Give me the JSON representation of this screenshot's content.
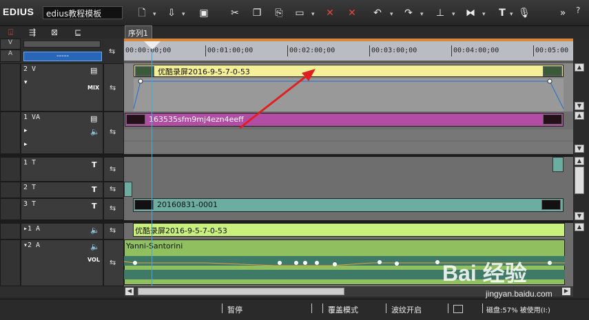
{
  "app": {
    "logo": "EDIUS",
    "project_name": "edius教程模板"
  },
  "toolbar": {
    "icons": [
      "new-file-icon",
      "open-icon",
      "save-icon",
      "cut-icon",
      "copy-icon",
      "paste-icon",
      "clip-icon",
      "delete-icon",
      "ripple-delete-icon",
      "undo-icon",
      "redo-icon",
      "split-icon",
      "group-icon",
      "title-icon",
      "mic-icon",
      "more-icon"
    ]
  },
  "sequence": {
    "tab_label": "序列1"
  },
  "left_tools": {
    "track_selector": "-----"
  },
  "ruler": {
    "ticks": [
      "00:00:00;00",
      "00:01:00;00",
      "00:02:00;00",
      "00:03:00;00",
      "00:04:00;00",
      "00:05:00"
    ]
  },
  "tracks": {
    "v2": {
      "name": "2 V",
      "mix_label": "MIX"
    },
    "va1": {
      "name": "1 VA"
    },
    "t1": {
      "name": "1 T",
      "icon": "T"
    },
    "t2": {
      "name": "2 T",
      "icon": "T"
    },
    "t3": {
      "name": "3 T",
      "icon": "T"
    },
    "a1": {
      "name": "▸1 A"
    },
    "a2": {
      "name": "▾2 A",
      "vol_label": "VOL"
    }
  },
  "clips": {
    "v2_clip": "优酷录屏2016-9-5-7-0-53",
    "va1_clip": "163535sfm9mj4ezn4eeff",
    "t3_clip": "20160831-0001",
    "a1_clip": "优酷录屏2016-9-5-7-0-53",
    "a2_clip": "Yanni-Santorini"
  },
  "status": {
    "pause": "暂停",
    "overwrite": "覆盖模式",
    "ripple": "波纹开启",
    "disk": "磁盘:57% 被使用(I:)"
  },
  "watermark": {
    "brand": "Bai 经验",
    "url": "jingyan.baidu.com"
  },
  "colors": {
    "v2_clip": "#f5ef98",
    "va1_clip": "#b14ea3",
    "t3_clip": "#6bada0",
    "a1_clip": "#c9ef7c",
    "a2_clip": "#8fbf5f",
    "playhead": "#4aa8d8",
    "arrow": "#e02020"
  }
}
